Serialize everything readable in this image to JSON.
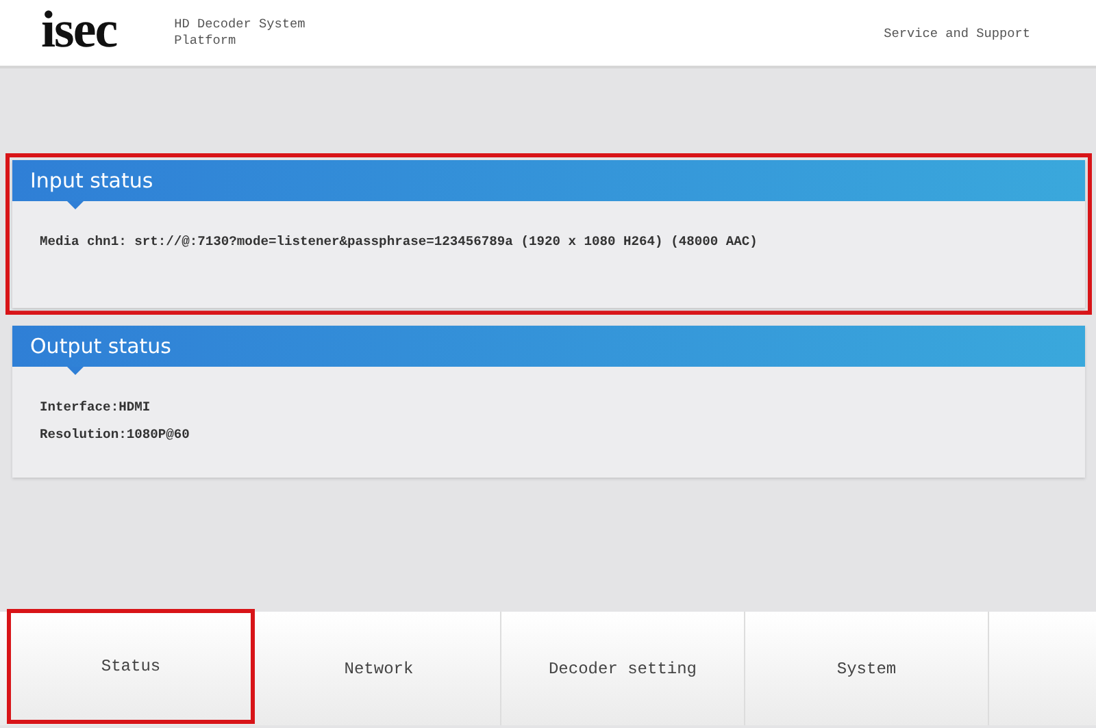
{
  "header": {
    "logo": "isec",
    "subtitle": "HD Decoder System Platform",
    "support_link": "Service and Support"
  },
  "panels": [
    {
      "title": "Input status",
      "highlighted": true,
      "lines": [
        "Media chn1: srt://@:7130?mode=listener&passphrase=123456789a (1920 x 1080 H264) (48000 AAC)"
      ]
    },
    {
      "title": "Output status",
      "highlighted": false,
      "lines": [
        "Interface:HDMI",
        "Resolution:1080P@60"
      ]
    }
  ],
  "tabs": [
    {
      "label": "Status",
      "highlighted": true
    },
    {
      "label": "Network",
      "highlighted": false
    },
    {
      "label": "Decoder setting",
      "highlighted": false
    },
    {
      "label": "System",
      "highlighted": false
    }
  ]
}
